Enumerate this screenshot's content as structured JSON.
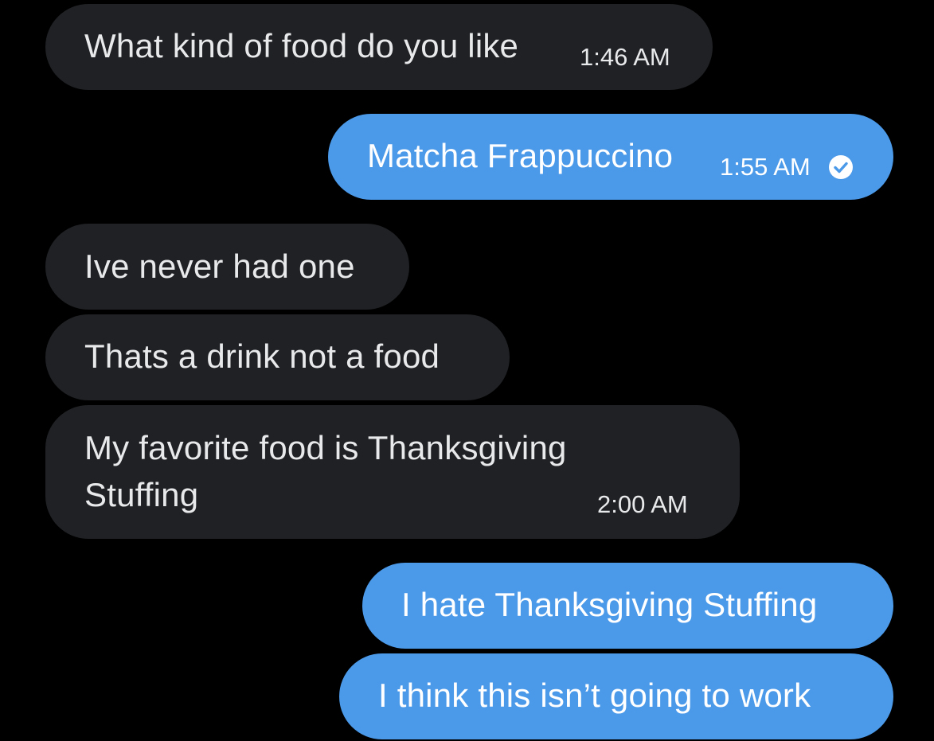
{
  "messages": [
    {
      "id": "m1",
      "direction": "incoming",
      "text": "What kind of food do you like",
      "time": "1:46 AM"
    },
    {
      "id": "m2",
      "direction": "outgoing",
      "text": "Matcha Frappuccino",
      "time": "1:55 AM",
      "status_icon": "read-check-icon"
    },
    {
      "id": "m3",
      "direction": "incoming",
      "text": "Ive never had one"
    },
    {
      "id": "m4",
      "direction": "incoming",
      "text": "Thats a drink not a food"
    },
    {
      "id": "m5",
      "direction": "incoming",
      "line1": "My favorite food is Thanksgiving",
      "line2": "Stuffing",
      "time": "2:00 AM"
    },
    {
      "id": "m6",
      "direction": "outgoing",
      "text": "I hate Thanksgiving Stuffing"
    },
    {
      "id": "m7",
      "direction": "outgoing",
      "text": "I think this isn’t going to work"
    }
  ],
  "colors": {
    "background": "#000000",
    "incoming_bubble": "#1f2124",
    "outgoing_bubble": "#4b99e9",
    "text": "#ffffff"
  }
}
